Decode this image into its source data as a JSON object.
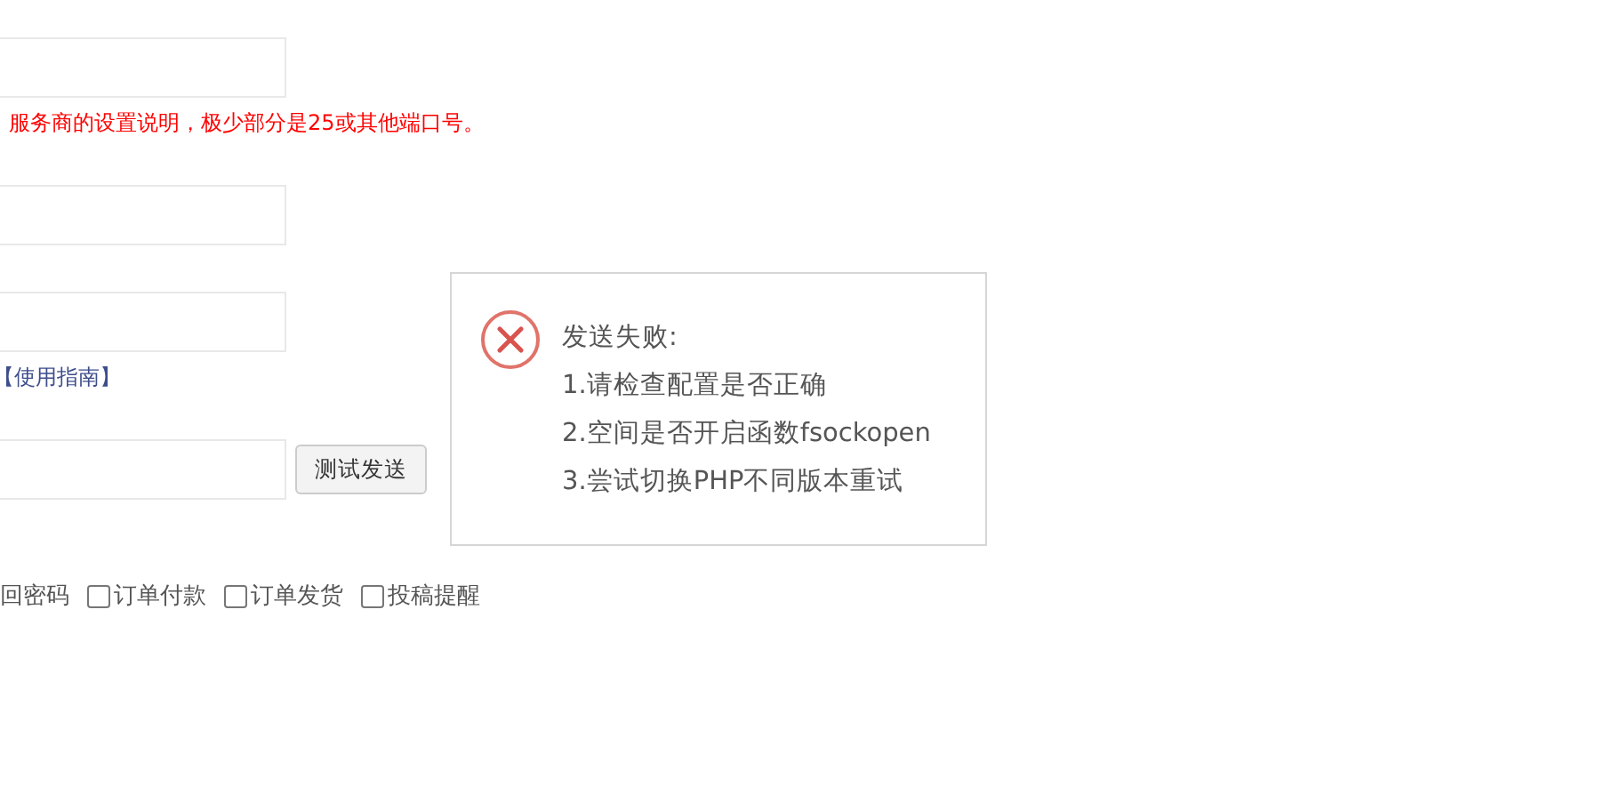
{
  "form": {
    "fields": [
      {
        "kind": "text",
        "note": {
          "kind": "warning",
          "text": "服务商的设置说明，极少部分是25或其他端口号。"
        }
      },
      {
        "kind": "text"
      },
      {
        "kind": "text",
        "note": {
          "kind": "link",
          "text": "【使用指南】"
        }
      },
      {
        "kind": "text",
        "button": "测试发送"
      }
    ],
    "notifications": [
      {
        "label": "回密码",
        "kind": "label"
      },
      {
        "label": "订单付款",
        "kind": "checkbox",
        "checked": false
      },
      {
        "label": "订单发货",
        "kind": "checkbox",
        "checked": false
      },
      {
        "label": "投稿提醒",
        "kind": "checkbox",
        "checked": false
      }
    ]
  },
  "dialog": {
    "kind": "error",
    "lines": [
      "发送失败:",
      "1.请检查配置是否正确",
      "2.空间是否开启函数fsockopen",
      "3.尝试切换PHP不同版本重试"
    ]
  }
}
